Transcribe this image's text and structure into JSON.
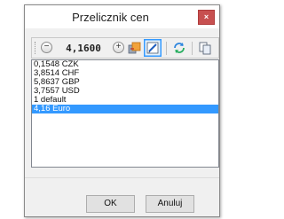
{
  "window": {
    "title": "Przelicznik cen",
    "close_label": "×"
  },
  "toolbar": {
    "decrement_label": "−",
    "rate_value": "4,1600",
    "increment_label": "+"
  },
  "currency_list": {
    "items": [
      "0,1548 CZK",
      "3,8514 CHF",
      "5,8637 GBP",
      "3,7557 USD",
      "1 default",
      "4,16 Euro"
    ],
    "selected_index": 5
  },
  "buttons": {
    "ok_label": "OK",
    "cancel_label": "Anuluj"
  },
  "colors": {
    "selection": "#3399ff",
    "close_button": "#c75050",
    "active_tool_border": "#3399ff"
  }
}
